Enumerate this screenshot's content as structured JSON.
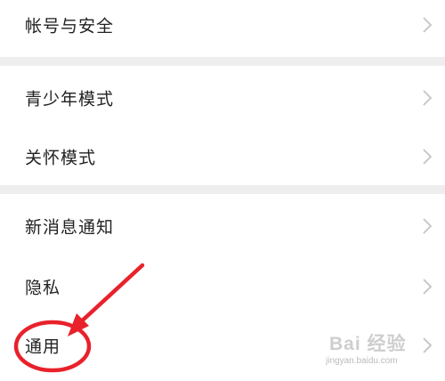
{
  "settings": {
    "items": [
      {
        "label": "帐号与安全"
      },
      {
        "label": "青少年模式"
      },
      {
        "label": "关怀模式"
      },
      {
        "label": "新消息通知"
      },
      {
        "label": "隐私"
      },
      {
        "label": "通用"
      }
    ]
  },
  "watermark": {
    "brand": "Bai 经验",
    "domain": "jingyan.baidu.com"
  },
  "colors": {
    "background": "#ffffff",
    "section_gap": "#eeeeee",
    "text": "#222222",
    "chevron": "#c4c4c4",
    "annotation": "#e8212b"
  },
  "icons": {
    "row_arrow": "chevron-right-icon"
  }
}
